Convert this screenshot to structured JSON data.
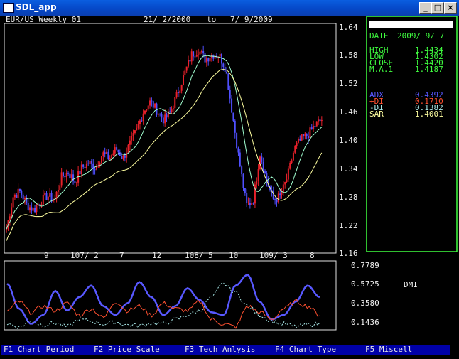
{
  "window": {
    "title": "SDL_app",
    "min": "_",
    "max": "□",
    "close": "×"
  },
  "header": {
    "symbol": "EUR/US Weekly 01",
    "start": "21/ 2/2000",
    "to": "to",
    "end": "7/ 9/2009"
  },
  "info": {
    "date_label": "DATE",
    "date_value": "2009/ 9/ 7",
    "ohlc": [
      {
        "label": "HIGH",
        "value": "1.4434"
      },
      {
        "label": "LOW",
        "value": "1.4302"
      },
      {
        "label": "CLOSE",
        "value": "1.4420"
      },
      {
        "label": "M.A.1",
        "value": "1.4187"
      }
    ],
    "indicators": [
      {
        "label": "ADX",
        "value": "0.4392",
        "color": "#5858ff"
      },
      {
        "label": "+DI",
        "value": "0.1710",
        "color": "#ff5030"
      },
      {
        "label": "-DI",
        "value": "0.1382",
        "color": "#a8e8e8"
      },
      {
        "label": "SAR",
        "value": "1.4001",
        "color": "#ffffa0"
      }
    ]
  },
  "price_axis": [
    "1.64",
    "1.58",
    "1.52",
    "1.46",
    "1.40",
    "1.34",
    "1.28",
    "1.22",
    "1.16"
  ],
  "time_axis": [
    "9",
    "107/ 2",
    "7",
    "12",
    "108/ 5",
    "10",
    "109/ 3",
    "8"
  ],
  "dmi_axis": [
    "0.7789",
    "0.5725",
    "0.3580",
    "0.1436"
  ],
  "dmi_label": "DMI",
  "fkeys": [
    "F1 Chart Period",
    "F2 Price Scale",
    "F3 Tech Anlysis",
    "F4 Chart Type",
    "F5 Miscell"
  ],
  "colors": {
    "bull": "#e8202a",
    "bear": "#5050ff",
    "ma": "#a0ffd0",
    "sar": "#ffffa0",
    "panel_border": "#40ff40",
    "fkey_bg": "#0000a8"
  },
  "chart_data": {
    "type": "candlestick",
    "title": "EUR/US Weekly 01",
    "price_axis": {
      "min": 1.16,
      "max": 1.64,
      "ticks": [
        1.64,
        1.58,
        1.52,
        1.46,
        1.4,
        1.34,
        1.28,
        1.22,
        1.16
      ]
    },
    "trend_closes": [
      1.21,
      1.28,
      1.29,
      1.26,
      1.25,
      1.27,
      1.28,
      1.27,
      1.32,
      1.33,
      1.31,
      1.34,
      1.35,
      1.34,
      1.37,
      1.36,
      1.38,
      1.36,
      1.39,
      1.42,
      1.46,
      1.48,
      1.46,
      1.44,
      1.46,
      1.5,
      1.54,
      1.58,
      1.59,
      1.57,
      1.58,
      1.58,
      1.55,
      1.45,
      1.35,
      1.26,
      1.27,
      1.37,
      1.31,
      1.27,
      1.28,
      1.32,
      1.38,
      1.4,
      1.41,
      1.43,
      1.442
    ],
    "dmi": {
      "axis_ticks": [
        0.7789,
        0.5725,
        0.358,
        0.1436
      ],
      "series": [
        {
          "name": "ADX",
          "values": [
            0.6,
            0.32,
            0.15,
            0.25,
            0.52,
            0.3,
            0.45,
            0.58,
            0.35,
            0.25,
            0.38,
            0.62,
            0.45,
            0.25,
            0.35,
            0.55,
            0.42,
            0.28,
            0.25,
            0.58,
            0.7,
            0.4,
            0.2,
            0.25,
            0.4,
            0.58,
            0.45
          ]
        },
        {
          "name": "+DI",
          "values": [
            0.3,
            0.4,
            0.28,
            0.35,
            0.3,
            0.38,
            0.25,
            0.32,
            0.22,
            0.4,
            0.3,
            0.35,
            0.25,
            0.38,
            0.32,
            0.3,
            0.4,
            0.2,
            0.15,
            0.12,
            0.35,
            0.28,
            0.2,
            0.32,
            0.4,
            0.35,
            0.25
          ]
        },
        {
          "name": "-DI",
          "values": [
            0.15,
            0.12,
            0.18,
            0.14,
            0.16,
            0.12,
            0.2,
            0.18,
            0.15,
            0.17,
            0.14,
            0.13,
            0.16,
            0.15,
            0.2,
            0.25,
            0.3,
            0.45,
            0.6,
            0.5,
            0.35,
            0.25,
            0.18,
            0.15,
            0.12,
            0.14,
            0.15
          ]
        }
      ]
    }
  }
}
